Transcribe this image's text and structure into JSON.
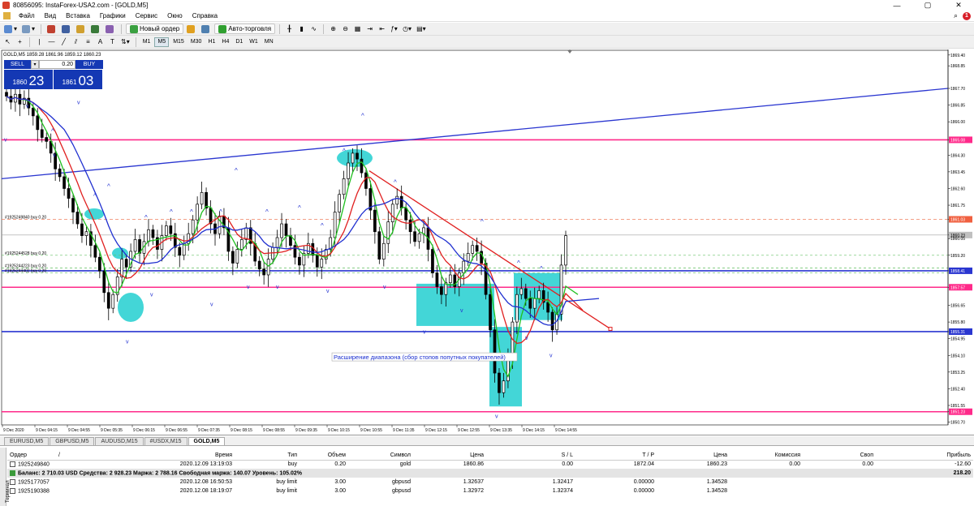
{
  "window": {
    "title": "80856095: InstaForex-USA2.com - [GOLD,M5]",
    "minimize": "—",
    "maximize": "▢",
    "close": "✕"
  },
  "menu": {
    "items": [
      "Файл",
      "Вид",
      "Вставка",
      "Графики",
      "Сервис",
      "Окно",
      "Справка"
    ],
    "notifications": "1"
  },
  "toolbar1": {
    "new_order_label": "Новый ордер",
    "autotrading_label": "Авто-торговля"
  },
  "toolbar2": {
    "timeframes": [
      "M1",
      "M5",
      "M15",
      "M30",
      "H1",
      "H4",
      "D1",
      "W1",
      "MN"
    ],
    "active_timeframe": "M5"
  },
  "chart": {
    "info_line": "GOLD,M5  1859.28 1861.96 1859.12 1860.23",
    "one_click": {
      "sell_label": "SELL",
      "buy_label": "BUY",
      "volume": "0.20",
      "sell_small": "1860",
      "sell_big": "23",
      "buy_small": "1861",
      "buy_big": "03"
    },
    "annotation": "Расширение диапазона (сбор стопов попутных покупателей)",
    "order_labels": [
      "#1925249840 buy 0.20",
      "#1925244528 buy 0.20",
      "#1925244223 buy 0.20",
      "#1925244402 buy 0.20"
    ],
    "price_ticks": [
      "1869.40",
      "1868.85",
      "1867.70",
      "1866.85",
      "1866.00",
      "1865.08",
      "1864.30",
      "1863.45",
      "1862.60",
      "1861.75",
      "1861.03",
      "1860.23",
      "1860.05",
      "1859.20",
      "1858.41",
      "1857.57",
      "1856.65",
      "1855.80",
      "1855.31",
      "1854.95",
      "1854.10",
      "1853.25",
      "1852.40",
      "1851.55",
      "1851.23",
      "1850.70"
    ],
    "highlighted_prices": {
      "pink_top": "1865.08",
      "red_dash": "1861.03",
      "current": "1860.23",
      "blue_mid": "1858.41",
      "pink_mid": "1857.57",
      "blue_low": "1855.31",
      "pink_low": "1851.23"
    },
    "time_ticks": [
      "9 Dec 2020",
      "9 Dec 04:15",
      "9 Dec 04:55",
      "9 Dec 05:35",
      "9 Dec 06:15",
      "9 Dec 06:55",
      "9 Dec 07:35",
      "9 Dec 08:15",
      "9 Dec 08:55",
      "9 Dec 09:35",
      "9 Dec 10:15",
      "9 Dec 10:55",
      "9 Dec 11:35",
      "9 Dec 12:15",
      "9 Dec 12:55",
      "9 Dec 13:35",
      "9 Dec 14:15",
      "9 Dec 14:55"
    ]
  },
  "tabs": {
    "items": [
      "EURUSD,M5",
      "GBPUSD,M5",
      "AUDUSD,M15",
      "#USDX,M15",
      "GOLD,M5"
    ],
    "active": "GOLD,M5"
  },
  "terminal": {
    "side_label": "Терминал",
    "headers": [
      "Ордер",
      "/",
      "Время",
      "Тип",
      "Объем",
      "Символ",
      "Цена",
      "S / L",
      "T / P",
      "Цена",
      "Комиссия",
      "Своп",
      "Прибыль"
    ],
    "rows": [
      {
        "order": "1925249840",
        "time": "2020.12.09 13:19:03",
        "type": "buy",
        "volume": "0.20",
        "symbol": "gold",
        "price": "1860.86",
        "sl": "0.00",
        "tp": "1872.04",
        "price2": "1860.23",
        "commission": "0.00",
        "swap": "0.00",
        "profit": "-12.60"
      },
      {
        "order": "1925177057",
        "time": "2020.12.08 16:50:53",
        "type": "buy limit",
        "volume": "3.00",
        "symbol": "gbpusd",
        "price": "1.32637",
        "sl": "1.32417",
        "tp": "0.00000",
        "price2": "1.34528",
        "commission": "",
        "swap": "",
        "profit": ""
      },
      {
        "order": "1925190388",
        "time": "2020.12.08 18:19:07",
        "type": "buy limit",
        "volume": "3.00",
        "symbol": "gbpusd",
        "price": "1.32972",
        "sl": "1.32374",
        "tp": "0.00000",
        "price2": "1.34528",
        "commission": "",
        "swap": "",
        "profit": ""
      }
    ],
    "balance_text": "Баланс: 2 710.03 USD  Средства: 2 928.23  Маржа: 2 788.16  Свободная маржа: 140.07  Уровень: 105.02%",
    "balance_profit": "218.20"
  }
}
